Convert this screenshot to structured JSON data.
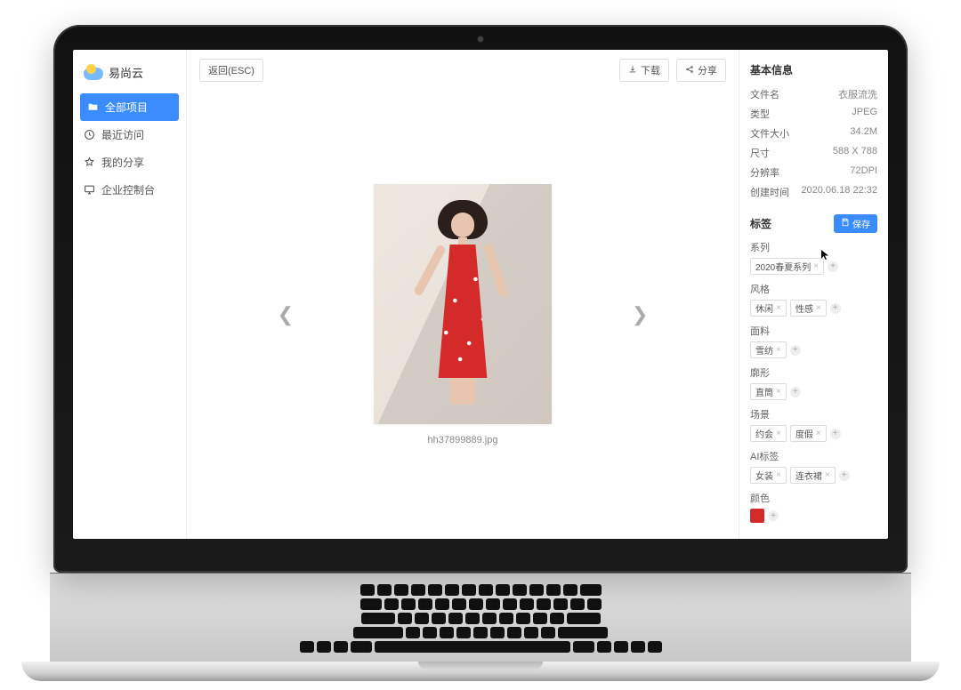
{
  "brand": "易尚云",
  "nav": {
    "all": "全部项目",
    "recent": "最近访问",
    "shared": "我的分享",
    "console": "企业控制台"
  },
  "toolbar": {
    "back": "返回(ESC)",
    "download": "下载",
    "share": "分享"
  },
  "file": {
    "name": "hh37899889.jpg"
  },
  "info": {
    "title": "基本信息",
    "fields": {
      "filename_k": "文件名",
      "filename_v": "衣服流洗",
      "type_k": "类型",
      "type_v": "JPEG",
      "size_k": "文件大小",
      "size_v": "34.2M",
      "dim_k": "尺寸",
      "dim_v": "588 X 788",
      "dpi_k": "分辨率",
      "dpi_v": "72DPI",
      "created_k": "创建时间",
      "created_v": "2020.06.18 22:32"
    }
  },
  "tags": {
    "title": "标签",
    "save": "保存",
    "groups": {
      "series": {
        "label": "系列",
        "items": [
          "2020春夏系列"
        ]
      },
      "style": {
        "label": "风格",
        "items": [
          "休闲",
          "性感"
        ]
      },
      "fabric": {
        "label": "面料",
        "items": [
          "雪纺"
        ]
      },
      "shape": {
        "label": "廓形",
        "items": [
          "直筒"
        ]
      },
      "scene": {
        "label": "场景",
        "items": [
          "约会",
          "度假"
        ]
      },
      "ai": {
        "label": "AI标签",
        "items": [
          "女装",
          "连衣裙"
        ]
      },
      "color": {
        "label": "颜色",
        "swatch": "#d42a2a"
      }
    }
  }
}
